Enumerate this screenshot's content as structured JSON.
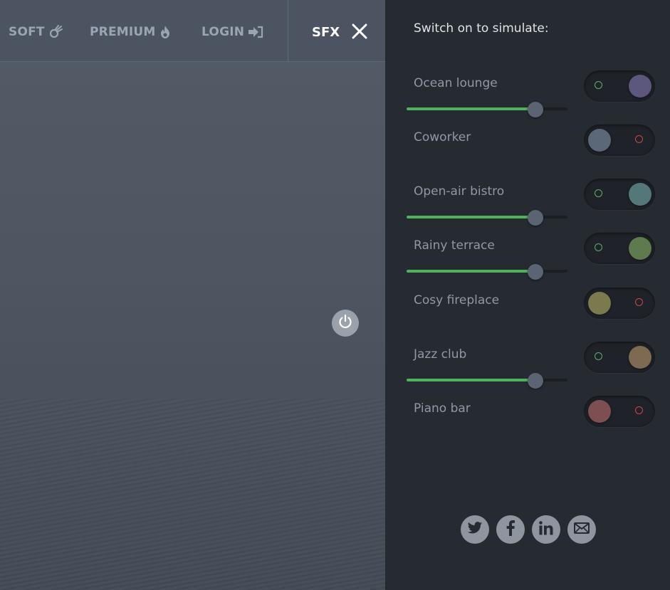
{
  "nav": {
    "soft_label": "SOFT",
    "premium_label": "PREMIUM",
    "login_label": "LOGIN",
    "sfx_label": "SFX",
    "icons": {
      "soft": "comet-icon",
      "premium": "flame-icon",
      "login": "sign-in-icon",
      "close": "close-icon"
    }
  },
  "main": {
    "power_icon": "power-icon"
  },
  "panel": {
    "heading": "Switch on to simulate:",
    "sounds": [
      {
        "label": "Ocean lounge",
        "on": true,
        "color": "#5b577d",
        "volume": 0.8
      },
      {
        "label": "Coworker",
        "on": false,
        "color": "#5b6878",
        "volume": null
      },
      {
        "label": "Open-air bistro",
        "on": true,
        "color": "#54787a",
        "volume": 0.8
      },
      {
        "label": "Rainy terrace",
        "on": true,
        "color": "#5e7a4f",
        "volume": 0.8
      },
      {
        "label": "Cosy fireplace",
        "on": false,
        "color": "#7b7a4c",
        "volume": null
      },
      {
        "label": "Jazz club",
        "on": true,
        "color": "#7e6a52",
        "volume": 0.8
      },
      {
        "label": "Piano bar",
        "on": false,
        "color": "#7d4e52",
        "volume": null
      }
    ],
    "social": [
      "twitter-icon",
      "facebook-icon",
      "linkedin-icon",
      "mail-icon"
    ]
  },
  "colors": {
    "on_indicator": "#58b068",
    "off_indicator": "#c94848",
    "slider_fill": "#4fb35c"
  }
}
